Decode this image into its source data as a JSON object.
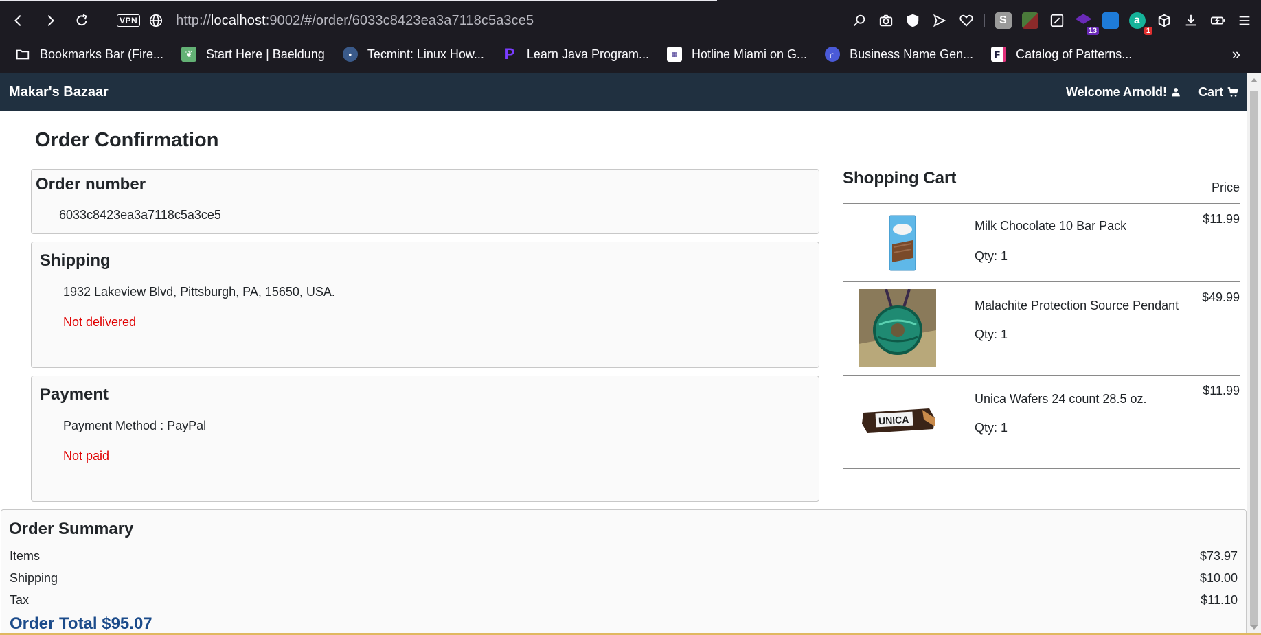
{
  "browser": {
    "url_host": "localhost",
    "url_prefix": "http://",
    "url_suffix": ":9002/#/order/6033c8423ea3a7118c5a3ce5",
    "vpn_label": "VPN",
    "extension_badges": {
      "graduation": "13",
      "grammarly": "1"
    },
    "bookmarks": [
      {
        "label": "Bookmarks Bar (Fire...",
        "icon": "folder-icon"
      },
      {
        "label": "Start Here | Baeldung",
        "icon": "leaf-icon"
      },
      {
        "label": "Tecmint: Linux How...",
        "icon": "penguin-icon"
      },
      {
        "label": "Learn Java Program...",
        "icon": "p-logo-icon"
      },
      {
        "label": "Hotline Miami on G...",
        "icon": "qr-logo-icon"
      },
      {
        "label": "Business Name Gen...",
        "icon": "magnet-logo-icon"
      },
      {
        "label": "Catalog of Patterns...",
        "icon": "f-logo-icon"
      }
    ]
  },
  "navbar": {
    "brand": "Makar's Bazaar",
    "welcome": "Welcome Arnold!",
    "cart": "Cart"
  },
  "page": {
    "title": "Order Confirmation",
    "order": {
      "heading": "Order number",
      "number": "6033c8423ea3a7118c5a3ce5"
    },
    "shipping": {
      "heading": "Shipping",
      "address": "1932 Lakeview Blvd, Pittsburgh, PA, 15650, USA.",
      "status": "Not delivered"
    },
    "payment": {
      "heading": "Payment",
      "method": "Payment Method : PayPal",
      "status": "Not paid"
    },
    "cart": {
      "heading": "Shopping Cart",
      "price_header": "Price",
      "items": [
        {
          "name": "Milk Chocolate 10 Bar Pack",
          "qty": "Qty: 1",
          "price": "$11.99"
        },
        {
          "name": "Malachite Protection Source Pendant",
          "qty": "Qty: 1",
          "price": "$49.99"
        },
        {
          "name": "Unica Wafers 24 count 28.5 oz.",
          "qty": "Qty: 1",
          "price": "$11.99"
        }
      ]
    },
    "summary": {
      "heading": "Order Summary",
      "rows": [
        {
          "label": "Items",
          "value": "$73.97"
        },
        {
          "label": "Shipping",
          "value": "$10.00"
        },
        {
          "label": "Tax",
          "value": "$11.10"
        }
      ],
      "total": "Order Total $95.07"
    }
  },
  "colors": {
    "navbar_bg": "#203040",
    "status_red": "#e00000",
    "total_blue": "#1b4b8a",
    "browser_bg": "#1c1b22"
  }
}
